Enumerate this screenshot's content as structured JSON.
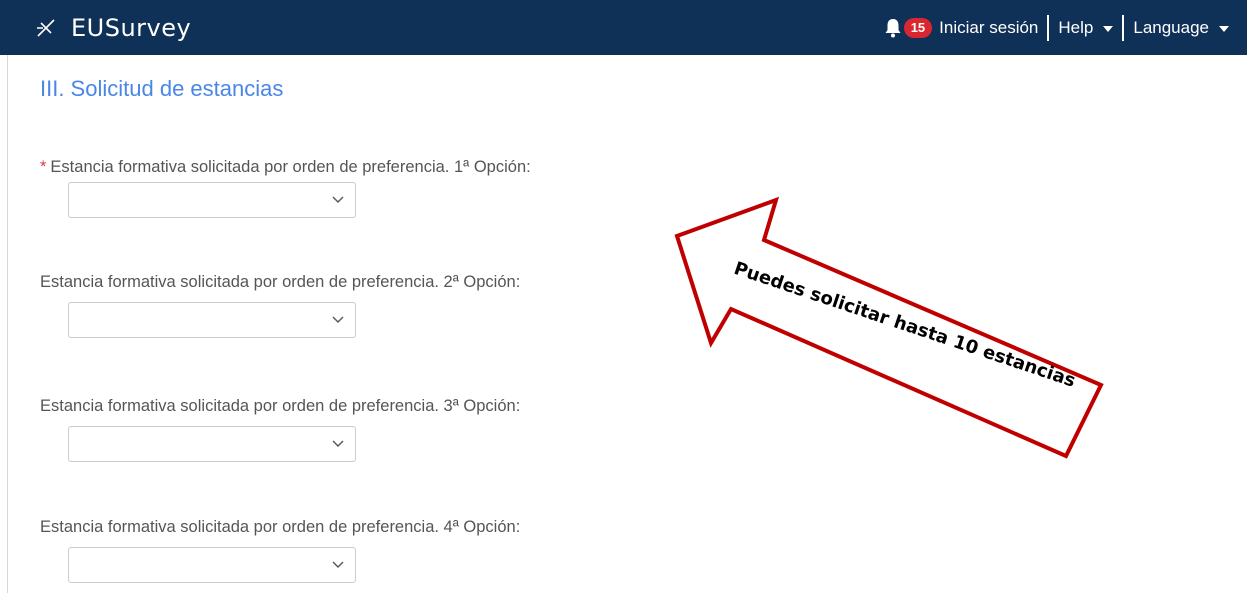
{
  "header": {
    "logo_text": "EUSurvey",
    "notification_count": "15",
    "login_label": "Iniciar sesión",
    "help_label": "Help",
    "language_label": "Language",
    "bg_color": "#0f3057"
  },
  "section": {
    "title": "III. Solicitud de estancias"
  },
  "questions": [
    {
      "required_mark": "*",
      "label": "Estancia formativa solicitada por orden de preferencia. 1ª Opción:",
      "value": ""
    },
    {
      "label": "Estancia formativa solicitada por orden de preferencia. 2ª Opción:",
      "value": ""
    },
    {
      "label": "Estancia formativa solicitada por orden de preferencia. 3ª Opción:",
      "value": ""
    },
    {
      "label": "Estancia formativa solicitada por orden de preferencia. 4ª Opción:",
      "value": ""
    }
  ],
  "callout": {
    "text": "Puedes solicitar hasta 10 estancias",
    "stroke_color": "#c00000"
  },
  "colors": {
    "accent": "#4a86e8",
    "required": "#e03b3b",
    "badge": "#d9262f"
  }
}
